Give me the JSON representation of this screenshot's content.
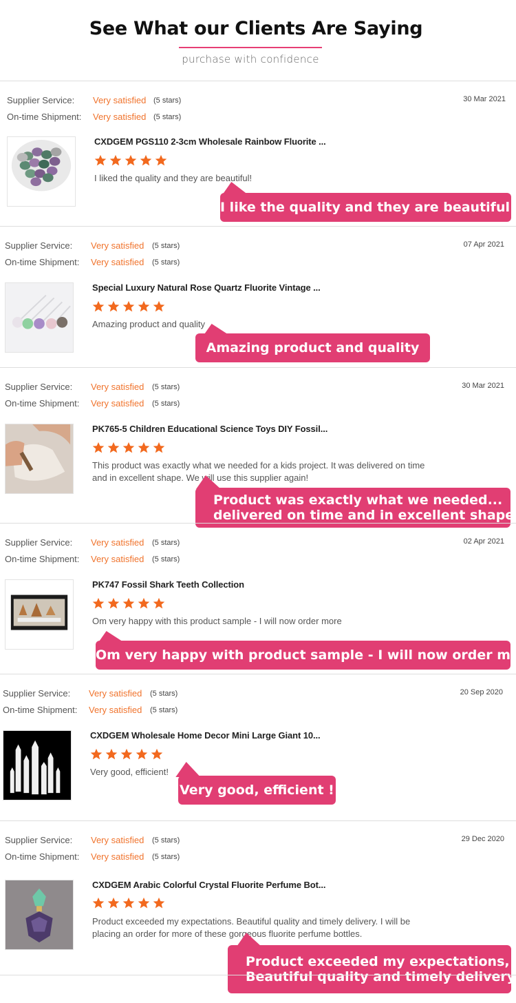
{
  "header": {
    "title": "See What our Clients Are Saying",
    "subtitle": "purchase with confidence"
  },
  "labels": {
    "supplier_service": "Supplier Service:",
    "on_time_shipment": "On-time Shipment:"
  },
  "colors": {
    "accent": "#e13e73",
    "rating_text": "#f0732c",
    "star": "#f2691e"
  },
  "reviews": [
    {
      "supplier_value": "Very satisfied",
      "supplier_stars": "(5 stars)",
      "shipment_value": "Very satisfied",
      "shipment_stars": "(5 stars)",
      "date": "30 Mar 2021",
      "product_title": "CXDGEM PGS110 2-3cm Wholesale Rainbow Fluorite ...",
      "rating": 5,
      "comment": "I liked the quality and they are beautiful!",
      "bubble": [
        "I like the quality and they are beautiful !"
      ],
      "image_icon": "tumbled-fluorite-stones-image"
    },
    {
      "supplier_value": "Very satisfied",
      "supplier_stars": "(5 stars)",
      "shipment_value": "Very satisfied",
      "shipment_stars": "(5 stars)",
      "date": "07 Apr 2021",
      "product_title": "Special Luxury Natural Rose Quartz Fluorite Vintage ...",
      "rating": 5,
      "comment": "Amazing product and quality",
      "bubble": [
        "Amazing product and quality"
      ],
      "image_icon": "crystal-wands-image"
    },
    {
      "supplier_value": "Very satisfied",
      "supplier_stars": "(5 stars)",
      "shipment_value": "Very satisfied",
      "shipment_stars": "(5 stars)",
      "date": "30 Mar 2021",
      "product_title": "PK765-5 Children Educational Science Toys DIY Fossil...",
      "rating": 5,
      "comment": "This product was exactly what we needed for a kids project. It was delivered on time and in excellent shape. We will use this supplier again!",
      "bubble": [
        "Product was exactly what we needed...",
        "delivered on time and in excellent shape..."
      ],
      "image_icon": "fossil-dig-kit-image"
    },
    {
      "supplier_value": "Very satisfied",
      "supplier_stars": "(5 stars)",
      "shipment_value": "Very satisfied",
      "shipment_stars": "(5 stars)",
      "date": "02 Apr 2021",
      "product_title": "PK747 Fossil Shark Teeth Collection",
      "rating": 5,
      "comment": "Om very happy with this product sample -  I will now order more",
      "bubble": [
        "Om very happy with product sample - I will now order more"
      ],
      "image_icon": "shark-teeth-box-image"
    },
    {
      "supplier_value": "Very satisfied",
      "supplier_stars": "(5 stars)",
      "shipment_value": "Very satisfied",
      "shipment_stars": "(5 stars)",
      "date": "20 Sep 2020",
      "product_title": "CXDGEM Wholesale Home Decor Mini Large Giant 10...",
      "rating": 5,
      "comment": "Very good, efficient!",
      "bubble": [
        "Very good, efficient !"
      ],
      "image_icon": "selenite-towers-image"
    },
    {
      "supplier_value": "Very satisfied",
      "supplier_stars": "(5 stars)",
      "shipment_value": "Very satisfied",
      "shipment_stars": "(5 stars)",
      "date": "29 Dec 2020",
      "product_title": "CXDGEM Arabic Colorful Crystal Fluorite Perfume Bot...",
      "rating": 5,
      "comment": "Product exceeded my expectations. Beautiful quality and timely delivery.  I will be placing an order for more of these gorgeous fluorite perfume bottles.",
      "bubble": [
        "Product exceeded my expectations,",
        "Beautiful quality and timely delivery ..."
      ],
      "image_icon": "fluorite-perfume-bottle-image"
    }
  ]
}
